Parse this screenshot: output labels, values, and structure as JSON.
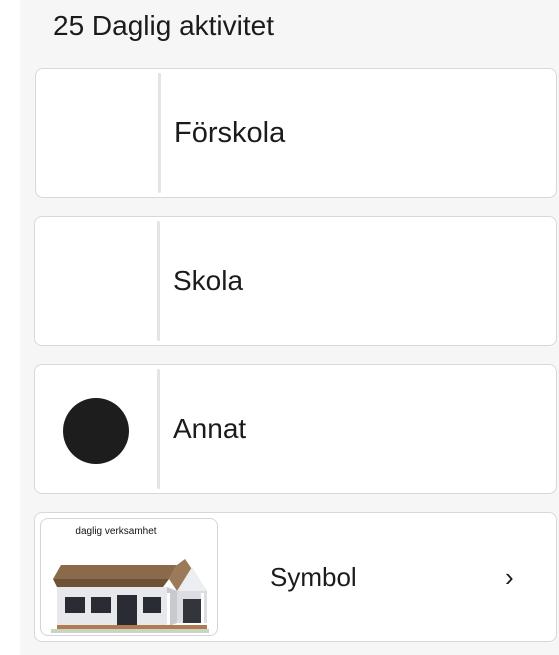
{
  "header": {
    "title": "25 Daglig aktivitet"
  },
  "options": [
    {
      "label": "Förskola",
      "symbol": "none"
    },
    {
      "label": "Skola",
      "symbol": "none"
    },
    {
      "label": "Annat",
      "symbol": "black-circle-icon"
    }
  ],
  "symbol_picker": {
    "caption": "daglig verksamhet",
    "image": "house-icon",
    "label": "Symbol",
    "chevron": "›"
  },
  "colors": {
    "panel_bg": "#f6f6f6",
    "card_bg": "#ffffff",
    "card_border": "#d8d8d8",
    "text": "#1b1b1b",
    "dot": "#1d1d1d"
  }
}
